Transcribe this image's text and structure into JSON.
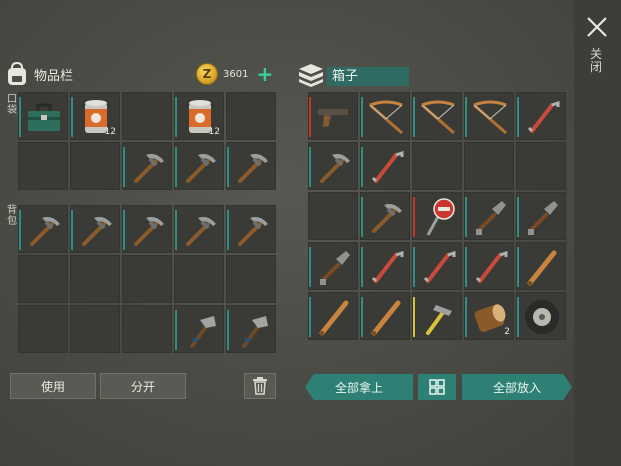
{
  "close": {
    "label": "关闭"
  },
  "inventory": {
    "title": "物品栏",
    "coins": "3601",
    "pocket_label": "口袋",
    "backpack_label": "背包",
    "pocket_slots": [
      {
        "item": "toolbox",
        "qty": ""
      },
      {
        "item": "canned-food",
        "qty": "12"
      },
      {
        "item": "",
        "qty": ""
      },
      {
        "item": "canned-food",
        "qty": "12"
      },
      {
        "item": "",
        "qty": ""
      },
      {
        "item": "",
        "qty": ""
      },
      {
        "item": "",
        "qty": ""
      },
      {
        "item": "pickaxe",
        "qty": ""
      },
      {
        "item": "pickaxe",
        "qty": ""
      },
      {
        "item": "pickaxe",
        "qty": ""
      }
    ],
    "backpack_slots": [
      {
        "item": "pickaxe"
      },
      {
        "item": "pickaxe"
      },
      {
        "item": "pickaxe"
      },
      {
        "item": "pickaxe"
      },
      {
        "item": "pickaxe"
      },
      {
        "item": ""
      },
      {
        "item": ""
      },
      {
        "item": ""
      },
      {
        "item": ""
      },
      {
        "item": ""
      },
      {
        "item": ""
      },
      {
        "item": ""
      },
      {
        "item": ""
      },
      {
        "item": "hatchet"
      },
      {
        "item": "hatchet"
      }
    ],
    "use_label": "使用",
    "split_label": "分开"
  },
  "box": {
    "title": "箱子",
    "slots": [
      {
        "item": "pistol",
        "qty": ""
      },
      {
        "item": "crossbow",
        "qty": ""
      },
      {
        "item": "crossbow",
        "qty": ""
      },
      {
        "item": "crossbow",
        "qty": ""
      },
      {
        "item": "crowbar",
        "qty": ""
      },
      {
        "item": "pickaxe",
        "qty": ""
      },
      {
        "item": "crowbar",
        "qty": ""
      },
      {
        "item": "",
        "qty": ""
      },
      {
        "item": "",
        "qty": ""
      },
      {
        "item": "",
        "qty": ""
      },
      {
        "item": "",
        "qty": ""
      },
      {
        "item": "pickaxe",
        "qty": ""
      },
      {
        "item": "stop-sign",
        "qty": ""
      },
      {
        "item": "shovel",
        "qty": ""
      },
      {
        "item": "shovel",
        "qty": ""
      },
      {
        "item": "shovel",
        "qty": ""
      },
      {
        "item": "crowbar",
        "qty": ""
      },
      {
        "item": "crowbar",
        "qty": ""
      },
      {
        "item": "crowbar",
        "qty": ""
      },
      {
        "item": "bat",
        "qty": ""
      },
      {
        "item": "bat",
        "qty": ""
      },
      {
        "item": "bat",
        "qty": ""
      },
      {
        "item": "hammer",
        "qty": ""
      },
      {
        "item": "log",
        "qty": "2"
      },
      {
        "item": "tire",
        "qty": ""
      }
    ],
    "take_all_label": "全部拿上",
    "put_all_label": "全部放入"
  },
  "colors": {
    "accent_teal": "#2e7f74",
    "coin": "#d9a526",
    "plus": "#33d0a0"
  }
}
